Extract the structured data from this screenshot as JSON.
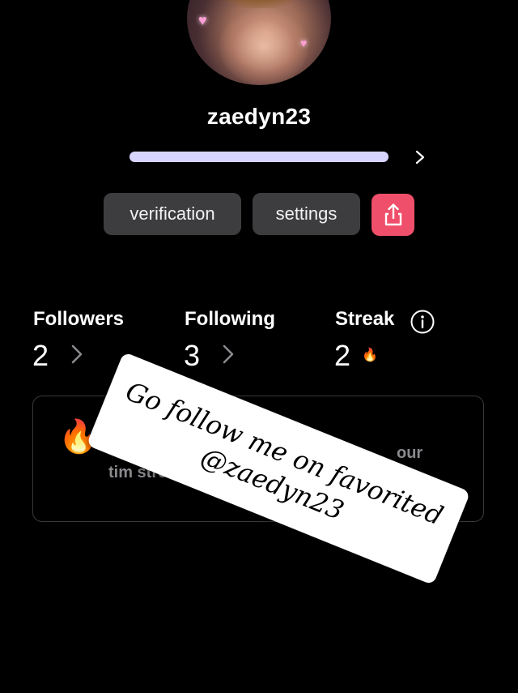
{
  "profile": {
    "username": "zaedyn23",
    "progress": 1.0
  },
  "buttons": {
    "verification_label": "verification",
    "settings_label": "settings",
    "share_icon": "share-icon"
  },
  "stats": {
    "followers_label": "Followers",
    "followers_value": "2",
    "following_label": "Following",
    "following_value": "3",
    "streak_label": "Streak",
    "streak_value": "2",
    "streak_icon": "🔥"
  },
  "streak_card": {
    "fire_emoji": "🔥",
    "text_left": "tim streak",
    "text_right": "our"
  },
  "overlay": {
    "line1": "Go follow me on favorited",
    "line2": "@zaedyn23"
  },
  "colors": {
    "background": "#000000",
    "progress": "#d7d4ff",
    "share_button": "#ef4f6b",
    "pill_button": "#3d3d40"
  }
}
